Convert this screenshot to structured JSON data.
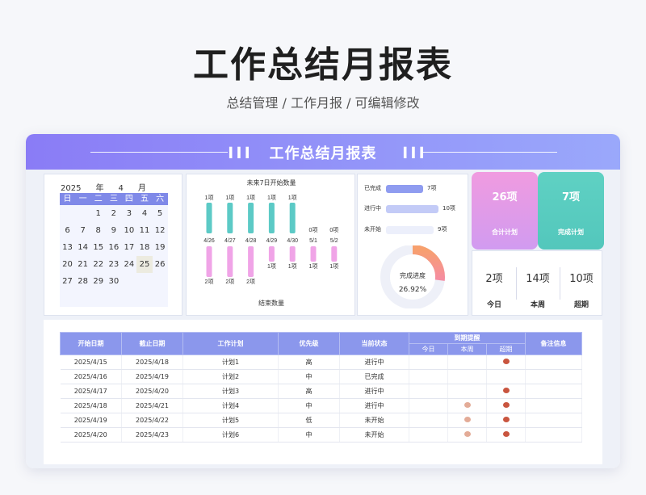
{
  "header": {
    "title": "工作总结月报表",
    "subtitle": "总结管理 / 工作月报 /  可编辑修改"
  },
  "banner": {
    "title": "工作总结月报表",
    "marks": "▍▍▍"
  },
  "calendar": {
    "year": "2025",
    "year_unit": "年",
    "month": "4",
    "month_unit": "月",
    "weekdays": [
      "日",
      "一",
      "二",
      "三",
      "四",
      "五",
      "六"
    ],
    "weeks": [
      [
        "",
        "",
        "1",
        "2",
        "3",
        "4",
        "5"
      ],
      [
        "6",
        "7",
        "8",
        "9",
        "10",
        "11",
        "12"
      ],
      [
        "13",
        "14",
        "15",
        "16",
        "17",
        "18",
        "19"
      ],
      [
        "20",
        "21",
        "22",
        "23",
        "24",
        "25",
        "26"
      ],
      [
        "27",
        "28",
        "29",
        "30",
        "",
        "",
        ""
      ],
      [
        "",
        "",
        "",
        "",
        "",
        "",
        ""
      ]
    ],
    "highlight": "25"
  },
  "chart_data": {
    "type": "bar",
    "title": "未来7日开始数量",
    "categories": [
      "4/26",
      "4/27",
      "4/28",
      "4/29",
      "4/30",
      "5/1",
      "5/2"
    ],
    "series": [
      {
        "name": "未来7日开始数量",
        "values": [
          1,
          1,
          1,
          1,
          1,
          0,
          0
        ],
        "labels": [
          "1项",
          "1项",
          "1项",
          "1项",
          "1项",
          "0项",
          "0项"
        ],
        "color": "#5ccac6"
      },
      {
        "name": "结束数量",
        "values": [
          2,
          2,
          2,
          1,
          1,
          1,
          1
        ],
        "labels": [
          "2项",
          "2项",
          "2项",
          "1项",
          "1项",
          "1项",
          "1项"
        ],
        "color": "#f0a4e7"
      }
    ],
    "footer": "结束数量"
  },
  "status": {
    "rows": [
      {
        "label": "已完成",
        "value": "7项",
        "fill": 0.7,
        "color": "#8f9cf0"
      },
      {
        "label": "进行中",
        "value": "10项",
        "fill": 1.0,
        "color": "#c3cbf7"
      },
      {
        "label": "未开始",
        "value": "9项",
        "fill": 0.9,
        "color": "#eceffb"
      }
    ],
    "progress_label": "完成进度",
    "progress_value": "26.92%",
    "progress": 0.2692
  },
  "kpis": [
    {
      "value": "26项",
      "label": "合计计划"
    },
    {
      "value": "7项",
      "label": "完成计划"
    }
  ],
  "periods": [
    {
      "value": "2项",
      "label": "今日"
    },
    {
      "value": "14项",
      "label": "本周"
    },
    {
      "value": "10项",
      "label": "超期"
    }
  ],
  "table": {
    "headers": [
      "开始日期",
      "截止日期",
      "工作计划",
      "优先级",
      "当前状态",
      "到期提醒",
      "备注信息"
    ],
    "sub_headers": [
      "今日",
      "本周",
      "超期"
    ],
    "rows": [
      {
        "start": "2025/4/15",
        "end": "2025/4/18",
        "plan": "计划1",
        "priority": "高",
        "status": "进行中",
        "today": false,
        "week": false,
        "overdue": true
      },
      {
        "start": "2025/4/16",
        "end": "2025/4/19",
        "plan": "计划2",
        "priority": "中",
        "status": "已完成",
        "today": false,
        "week": false,
        "overdue": false
      },
      {
        "start": "2025/4/17",
        "end": "2025/4/20",
        "plan": "计划3",
        "priority": "高",
        "status": "进行中",
        "today": false,
        "week": false,
        "overdue": true
      },
      {
        "start": "2025/4/18",
        "end": "2025/4/21",
        "plan": "计划4",
        "priority": "中",
        "status": "进行中",
        "today": false,
        "week": true,
        "overdue": true
      },
      {
        "start": "2025/4/19",
        "end": "2025/4/22",
        "plan": "计划5",
        "priority": "低",
        "status": "未开始",
        "today": false,
        "week": true,
        "overdue": true
      },
      {
        "start": "2025/4/20",
        "end": "2025/4/23",
        "plan": "计划6",
        "priority": "中",
        "status": "未开始",
        "today": false,
        "week": true,
        "overdue": true
      }
    ],
    "colors": {
      "week_dot": "#e3ab97",
      "overdue_dot": "#c9553f"
    }
  }
}
